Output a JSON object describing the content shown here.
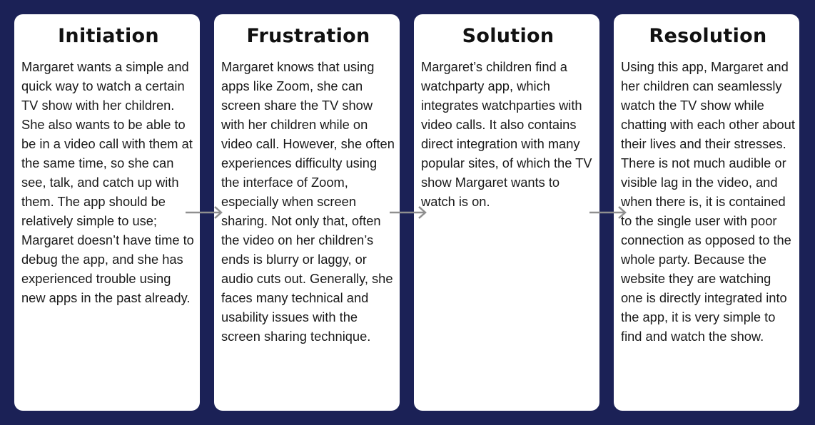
{
  "colors": {
    "background": "#1b2156",
    "card": "#ffffff",
    "arrow": "#8f8f8f",
    "text": "#1a1a1a"
  },
  "stages": [
    {
      "title": "Initiation",
      "body": "Margaret wants a simple and quick way to watch a certain TV show with her children. She also wants to be able to be in a video call with them at the same time, so she can see, talk, and catch up with them. The app should be relatively simple to use; Margaret doesn’t have time to debug the app, and she has experienced trouble using new apps in the past already."
    },
    {
      "title": "Frustration",
      "body": "Margaret knows that using apps like Zoom, she can screen share the TV show with her children while on video call. However, she often experiences difficulty using the interface of Zoom, especially when screen sharing. Not only that, often the video on her children’s ends is blurry or laggy, or audio cuts out. Generally, she faces many technical and usability issues with the screen sharing technique."
    },
    {
      "title": "Solution",
      "body": "Margaret’s children find a watchparty app, which integrates watchparties with video calls. It also contains direct integration with many popular sites, of which the TV show Margaret wants to watch is on."
    },
    {
      "title": "Resolution",
      "body": "Using this app, Margaret and her children can seamlessly watch the TV show while chatting with each other about their lives and their stresses. There is not much audible or visible lag in the video, and when there is, it is contained to the single user with poor connection as opposed to the whole party. Because the website they are watching one is directly integrated into the app, it is very simple to find and watch the show."
    }
  ],
  "arrows": [
    {
      "icon": "arrow-right-icon"
    },
    {
      "icon": "arrow-right-icon"
    },
    {
      "icon": "arrow-right-icon"
    }
  ]
}
